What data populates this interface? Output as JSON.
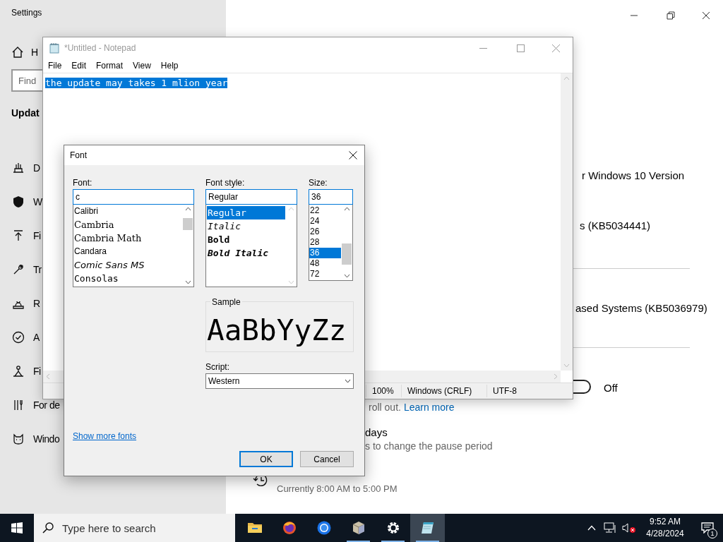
{
  "settings": {
    "title": "Settings",
    "home": "H",
    "search_placeholder": "Find",
    "heading": "Updat",
    "nav_items": [
      {
        "label": "D"
      },
      {
        "label": "W"
      },
      {
        "label": "Fi"
      },
      {
        "label": "Tr"
      },
      {
        "label": "R"
      },
      {
        "label": "A"
      },
      {
        "label": "Fi"
      },
      {
        "label": "For de"
      },
      {
        "label": "Windo"
      }
    ],
    "update_lines": [
      "r Windows 10 Version",
      "s (KB5034441)",
      "ased Systems (KB5036979)"
    ],
    "toggle": {
      "on": false,
      "label": "Off"
    },
    "rollout_text": "roll out.",
    "learn_more": "Learn more",
    "pause_title": "days",
    "pause_hint": "s to change the pause period",
    "active_hours": "Currently 8:00 AM to 5:00 PM"
  },
  "notepad": {
    "title": "*Untitled - Notepad",
    "menu": [
      "File",
      "Edit",
      "Format",
      "View",
      "Help"
    ],
    "text": "the update may takes 1 mlion year",
    "status": [
      "100%",
      "Windows (CRLF)",
      "UTF-8"
    ]
  },
  "font_dialog": {
    "title": "Font",
    "font_label": "Font:",
    "font_value": "c",
    "fonts": [
      {
        "label": "Calibri",
        "kind": "sans"
      },
      {
        "label": "Cambria",
        "kind": "serif"
      },
      {
        "label": "Cambria Math",
        "kind": "serif"
      },
      {
        "label": "Candara",
        "kind": "sans"
      },
      {
        "label": "Comic Sans MS",
        "kind": "script"
      },
      {
        "label": "Consolas",
        "kind": "mono"
      }
    ],
    "style_label": "Font style:",
    "style_value": "Regular",
    "styles": [
      {
        "label": "Regular",
        "kind": "regular",
        "selected": true
      },
      {
        "label": "Italic",
        "kind": "italic",
        "selected": false
      },
      {
        "label": "Bold",
        "kind": "bold",
        "selected": false
      },
      {
        "label": "Bold Italic",
        "kind": "bold_italic",
        "selected": false
      }
    ],
    "size_label": "Size:",
    "size_value": "36",
    "sizes": [
      {
        "label": "22",
        "selected": false
      },
      {
        "label": "24",
        "selected": false
      },
      {
        "label": "26",
        "selected": false
      },
      {
        "label": "28",
        "selected": false
      },
      {
        "label": "36",
        "selected": true
      },
      {
        "label": "48",
        "selected": false
      },
      {
        "label": "72",
        "selected": false
      }
    ],
    "sample_label": "Sample",
    "sample_text": "AaBbYyZz",
    "script_label": "Script:",
    "script_value": "Western",
    "more_fonts_link": "Show more fonts",
    "buttons": [
      {
        "label": "OK",
        "default": true
      },
      {
        "label": "Cancel",
        "default": false
      }
    ]
  },
  "taskbar": {
    "search_placeholder": "Type here to search",
    "apps": [
      {
        "running": false,
        "selected": false
      },
      {
        "running": false,
        "selected": false
      },
      {
        "running": false,
        "selected": false
      },
      {
        "running": true,
        "selected": false
      },
      {
        "running": true,
        "selected": false
      },
      {
        "running": true,
        "selected": true
      }
    ],
    "time": "9:52 AM",
    "date": "4/28/2024",
    "notifications": "1"
  }
}
